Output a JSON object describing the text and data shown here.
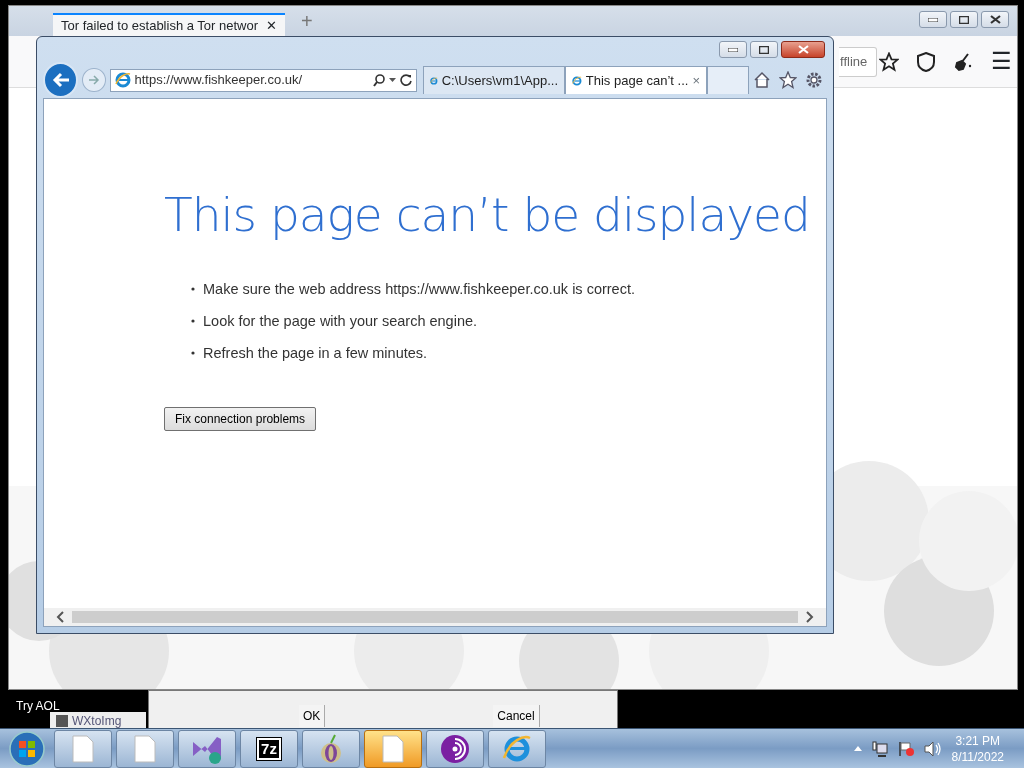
{
  "back_window": {
    "tab": {
      "label": "Tor failed to establish a Tor networ",
      "close": "✕"
    },
    "new_tab": "+",
    "field_value": "ffline",
    "menu": "☰"
  },
  "ie_window": {
    "address": "https://www.fishkeeper.co.uk/",
    "tabs": [
      {
        "label": "C:\\Users\\vm1\\App...",
        "selected": false
      },
      {
        "label": "This page can’t ...",
        "selected": true,
        "close": "×"
      }
    ],
    "heading": "This page can’t be displayed",
    "bullets": [
      "Make sure the web address https://www.fishkeeper.co.uk is correct.",
      "Look for the page with your search engine.",
      "Refresh the page in a few minutes."
    ],
    "button": "Fix connection problems"
  },
  "dialog": {
    "buttons": [
      "OK",
      "Cancel"
    ]
  },
  "desktop": {
    "ad_text": "Try AOL",
    "window_label": "WXtoImg"
  },
  "taskbar": {
    "items": [
      {
        "kind": "file",
        "selected": false
      },
      {
        "kind": "file",
        "selected": false
      },
      {
        "kind": "studio",
        "selected": false
      },
      {
        "kind": "archive",
        "label": "7z",
        "selected": false
      },
      {
        "kind": "onion",
        "selected": false
      },
      {
        "kind": "file",
        "selected": true
      },
      {
        "kind": "torbrowser",
        "selected": false
      },
      {
        "kind": "ie",
        "selected": false
      }
    ],
    "time": "3:21 PM",
    "date": "8/11/2022"
  }
}
